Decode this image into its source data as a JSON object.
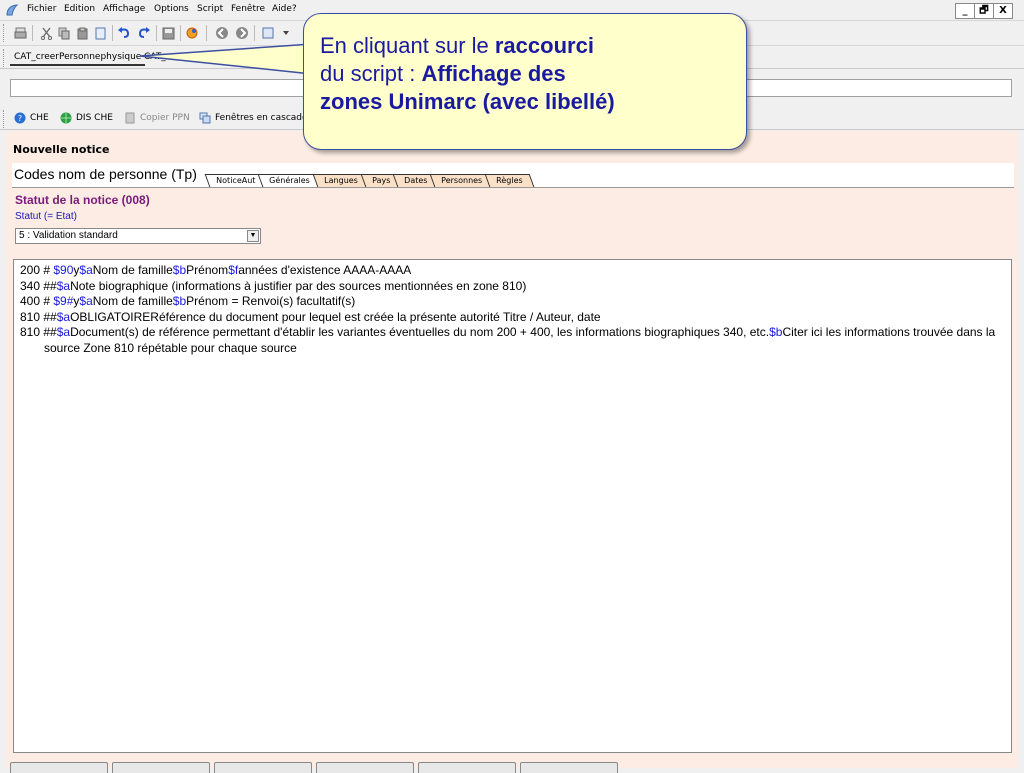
{
  "menu": {
    "items": [
      {
        "label": "Fichier"
      },
      {
        "label": "Edition"
      },
      {
        "label": "Affichage"
      },
      {
        "label": "Options"
      },
      {
        "label": "Script"
      },
      {
        "label": "Fenêtre"
      },
      {
        "label": "Aide?"
      }
    ],
    "window_controls": [
      "_",
      "🗗",
      "X"
    ]
  },
  "script_tabs": [
    "CAT_creerPersonnephysique",
    "CAT_creer..."
  ],
  "command": {
    "value": ""
  },
  "shortcuts": [
    {
      "label": "CHE",
      "icon": "help-icon",
      "color": "#2a6fd6"
    },
    {
      "label": "DIS CHE",
      "icon": "globe-icon",
      "color": "#2aa040"
    },
    {
      "label": "Copier PPN",
      "icon": "document-icon",
      "color": "#bbbbbb"
    },
    {
      "label": "Fenêtres en cascade",
      "icon": "cascade-icon",
      "color": "#6aa0d8"
    }
  ],
  "notice": {
    "title": "Nouvelle notice",
    "codes_title": "Codes nom de personne (Tp)",
    "tabs": [
      "NoticeAut",
      "Générales",
      "Langues",
      "Pays",
      "Dates",
      "Personnes",
      "Règles"
    ],
    "statut_title": "Statut de la notice (008)",
    "statut_label": "Statut (= Etat)",
    "statut_value": "5 : Validation standard"
  },
  "editor": {
    "lines": [
      {
        "segments": [
          {
            "t": "200 # ",
            "c": "n"
          },
          {
            "t": "$90",
            "c": "s"
          },
          {
            "t": "y",
            "c": "n"
          },
          {
            "t": "$a",
            "c": "s"
          },
          {
            "t": "Nom de famille",
            "c": "n"
          },
          {
            "t": "$b",
            "c": "s"
          },
          {
            "t": "Prénom",
            "c": "n"
          },
          {
            "t": "$f",
            "c": "s"
          },
          {
            "t": "années d'existence AAAA-AAAA",
            "c": "n"
          }
        ]
      },
      {
        "segments": [
          {
            "t": "340 ##",
            "c": "n"
          },
          {
            "t": "$a",
            "c": "s"
          },
          {
            "t": "Note biographique (informations à justifier par des sources mentionnées en zone 810)",
            "c": "n"
          }
        ]
      },
      {
        "segments": [
          {
            "t": "400 # ",
            "c": "n"
          },
          {
            "t": "$9#",
            "c": "s"
          },
          {
            "t": "y",
            "c": "n"
          },
          {
            "t": "$a",
            "c": "s"
          },
          {
            "t": "Nom de famille",
            "c": "n"
          },
          {
            "t": "$b",
            "c": "s"
          },
          {
            "t": "Prénom = Renvoi(s) facultatif(s)",
            "c": "n"
          }
        ]
      },
      {
        "segments": [
          {
            "t": "810 ##",
            "c": "n"
          },
          {
            "t": "$a",
            "c": "s"
          },
          {
            "t": "OBLIGATOIRERéférence du document pour lequel est créée la présente autorité Titre / Auteur, date",
            "c": "n"
          }
        ]
      },
      {
        "wrap": true,
        "segments": [
          {
            "t": "810 ##",
            "c": "n"
          },
          {
            "t": "$a",
            "c": "s"
          },
          {
            "t": "Document(s) de référence permettant d'établir les variantes éventuelles du nom 200 + 400, les informations biographiques 340, etc.",
            "c": "n"
          },
          {
            "t": "$b",
            "c": "s"
          },
          {
            "t": "Citer ici les informations trouvée dans la source Zone 810 répétable pour chaque source",
            "c": "n"
          }
        ]
      }
    ]
  },
  "callout": {
    "line1_pre": "En cliquant sur le ",
    "line1_bold": "raccourci",
    "line2_pre": "du script : ",
    "line2_bold": "Affichage des",
    "line3_bold": "zones Unimarc (avec libellé)"
  }
}
